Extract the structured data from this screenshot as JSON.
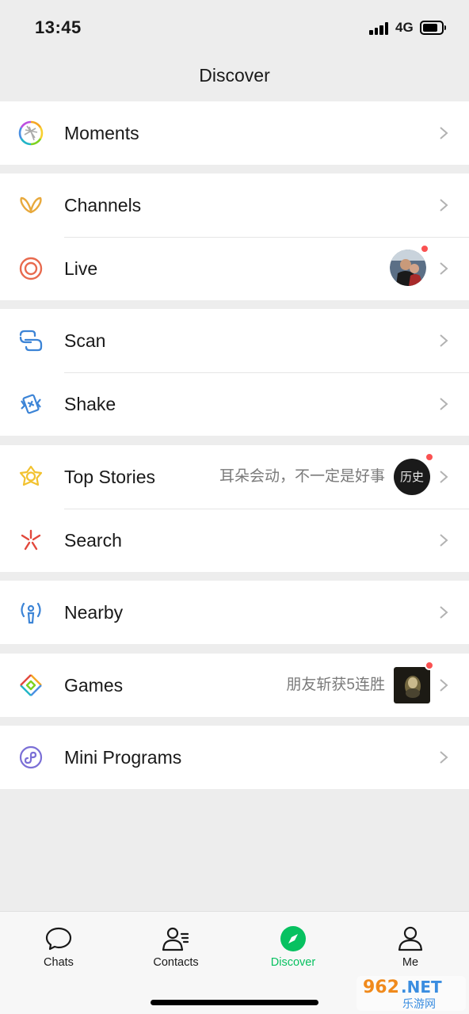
{
  "status_bar": {
    "time": "13:45",
    "network": "4G"
  },
  "nav": {
    "title": "Discover"
  },
  "groups": [
    {
      "rows": [
        {
          "label": "Moments",
          "icon": "moments-icon"
        }
      ]
    },
    {
      "rows": [
        {
          "label": "Channels",
          "icon": "channels-icon"
        },
        {
          "label": "Live",
          "icon": "live-icon",
          "thumbnail": "live-avatar",
          "red_dot": true
        }
      ]
    },
    {
      "rows": [
        {
          "label": "Scan",
          "icon": "scan-icon"
        },
        {
          "label": "Shake",
          "icon": "shake-icon"
        }
      ]
    },
    {
      "rows": [
        {
          "label": "Top Stories",
          "icon": "top-stories-icon",
          "subtitle": "耳朵会动，不一定是好事",
          "thumbnail_text": "历史",
          "red_dot": true
        },
        {
          "label": "Search",
          "icon": "search-icon"
        }
      ]
    },
    {
      "rows": [
        {
          "label": "Nearby",
          "icon": "nearby-icon"
        }
      ]
    },
    {
      "rows": [
        {
          "label": "Games",
          "icon": "games-icon",
          "subtitle": "朋友斩获5连胜",
          "thumbnail": "game-thumbnail",
          "red_dot": true
        }
      ]
    },
    {
      "rows": [
        {
          "label": "Mini Programs",
          "icon": "mini-programs-icon"
        }
      ]
    }
  ],
  "tabs": [
    {
      "label": "Chats",
      "icon": "chat-bubble-icon",
      "active": false
    },
    {
      "label": "Contacts",
      "icon": "contacts-icon",
      "active": false
    },
    {
      "label": "Discover",
      "icon": "compass-icon",
      "active": true
    },
    {
      "label": "Me",
      "icon": "person-icon",
      "active": false
    }
  ],
  "colors": {
    "accent": "#07c160",
    "background": "#ededed",
    "red_dot": "#fa5151"
  },
  "watermark": {
    "text_main": "962.NET",
    "text_sub": "乐游网"
  }
}
